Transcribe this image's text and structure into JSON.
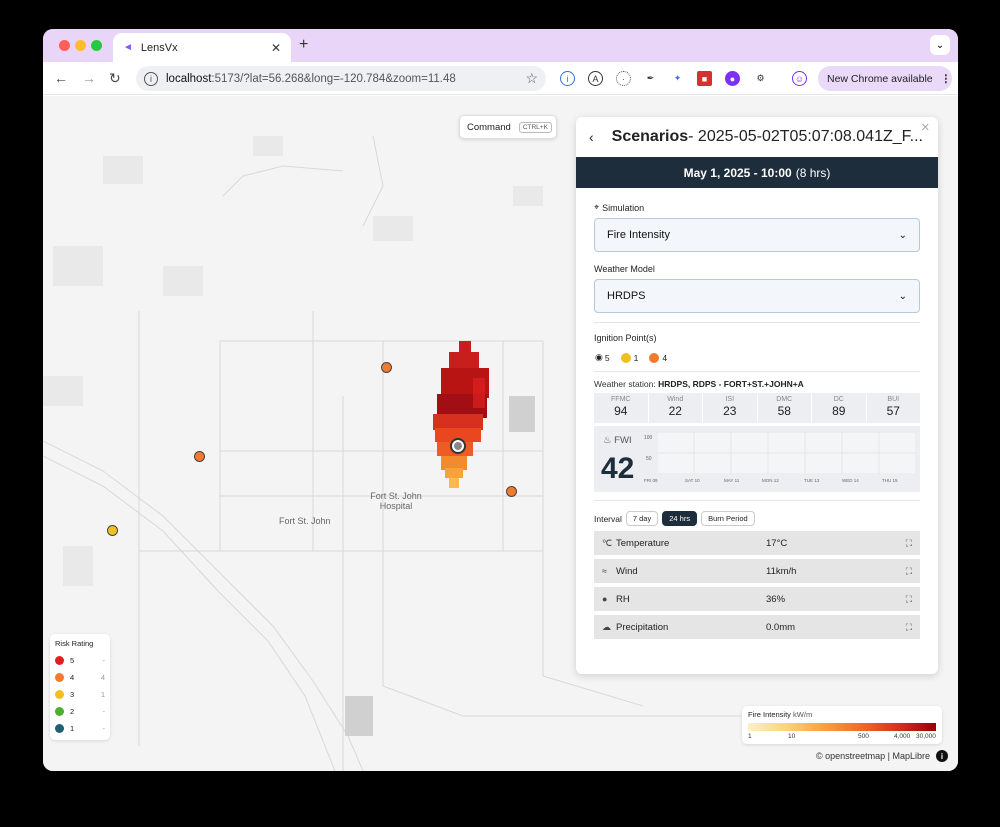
{
  "browser": {
    "tab_title": "LensVx",
    "url_host": "localhost",
    "url_rest": ":5173/?lat=56.268&long=-120.784&zoom=11.48",
    "new_chrome": "New Chrome available"
  },
  "map": {
    "command_label": "Command",
    "command_kbd": "CTRL+K",
    "labels": {
      "fort_st_john": "Fort St. John",
      "hospital": "Fort St. John\nHospital"
    },
    "attribution": "© openstreetmap | MapLibre",
    "risk_legend": {
      "title": "Risk Rating",
      "items": [
        {
          "level": "5",
          "count": "-",
          "color": "#e02020"
        },
        {
          "level": "4",
          "count": "4",
          "color": "#f07a30"
        },
        {
          "level": "3",
          "count": "1",
          "color": "#f0c020"
        },
        {
          "level": "2",
          "count": "-",
          "color": "#4caf30"
        },
        {
          "level": "1",
          "count": "-",
          "color": "#1f5f73"
        }
      ]
    },
    "fire_legend": {
      "title": "Fire Intensity",
      "unit": "kW/m",
      "ticks": [
        "1",
        "10",
        "500",
        "4,000",
        "30,000"
      ]
    }
  },
  "panel": {
    "title": "Scenarios",
    "title_suffix": " - 2025-05-02T05:07:08.041Z_F...",
    "date": "May 1, 2025 - 10:00",
    "duration": "(8 hrs)",
    "simulation_label": "Simulation",
    "simulation_value": "Fire Intensity",
    "weather_model_label": "Weather Model",
    "weather_model_value": "HRDPS",
    "ignition_label": "Ignition Point(s)",
    "ignition_counts": {
      "eye": "5",
      "yellow": "1",
      "orange": "4"
    },
    "weather_station_prefix": "Weather station: ",
    "weather_station": "HRDPS, RDPS - FORT+ST.+JOHN+A",
    "indices": [
      {
        "k": "FFMC",
        "v": "94"
      },
      {
        "k": "Wind",
        "v": "22"
      },
      {
        "k": "ISI",
        "v": "23"
      },
      {
        "k": "DMC",
        "v": "58"
      },
      {
        "k": "DC",
        "v": "89"
      },
      {
        "k": "BUI",
        "v": "57"
      }
    ],
    "fwi_label": "FWI",
    "fwi_value": "42",
    "fwi_axis": [
      "100",
      "50"
    ],
    "fwi_days": [
      "FRI 09",
      "SAT 10",
      "MAY 11",
      "MON 12",
      "TUE 13",
      "WED 14",
      "THU 15"
    ],
    "interval_label": "Interval",
    "interval_options": [
      "7 day",
      "24 hrs",
      "Burn Period"
    ],
    "interval_active": "24 hrs",
    "weather_rows": [
      {
        "label": "Temperature",
        "value": "17°C"
      },
      {
        "label": "Wind",
        "value": "11km/h"
      },
      {
        "label": "RH",
        "value": "36%"
      },
      {
        "label": "Precipitation",
        "value": "0.0mm"
      }
    ]
  }
}
